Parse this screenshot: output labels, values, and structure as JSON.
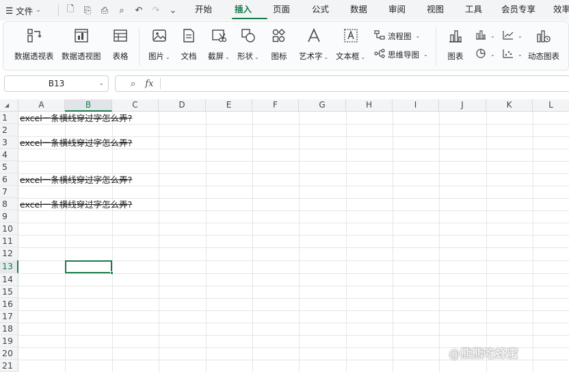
{
  "menubar": {
    "file_label": "文件",
    "tabs": [
      "开始",
      "插入",
      "页面",
      "公式",
      "数据",
      "审阅",
      "视图",
      "工具",
      "会员专享",
      "效率"
    ],
    "active_tab": "插入"
  },
  "ribbon": {
    "pivot_table": "数据透视表",
    "pivot_chart": "数据透视图",
    "table": "表格",
    "picture": "图片",
    "document": "文档",
    "screenshot": "截屏",
    "shape": "形状",
    "icon": "图标",
    "wordart": "艺术字",
    "textbox": "文本框",
    "flowchart": "流程图",
    "mindmap": "思维导图",
    "chart": "图表",
    "dynamic_chart": "动态图表"
  },
  "formula_bar": {
    "name_box": "B13",
    "fx_label": "fx",
    "value": ""
  },
  "sheet": {
    "columns": [
      "A",
      "B",
      "C",
      "D",
      "E",
      "F",
      "G",
      "H",
      "I",
      "J",
      "K",
      "L"
    ],
    "rows": [
      "1",
      "2",
      "3",
      "4",
      "5",
      "6",
      "7",
      "8",
      "9",
      "10",
      "11",
      "12",
      "13",
      "14",
      "15",
      "16",
      "17",
      "18",
      "19",
      "20",
      "21"
    ],
    "cells": {
      "A1": "excel一条横线穿过字怎么弄?",
      "A3": "excel一条横线穿过字怎么弄?",
      "A6": "excel一条横线穿过字怎么弄?",
      "A8": "excel一条横线穿过字怎么弄?"
    },
    "selected_cell": "B13"
  },
  "watermark": "@熊熊吃蜂蜜",
  "colors": {
    "accent": "#1a7a4a"
  }
}
